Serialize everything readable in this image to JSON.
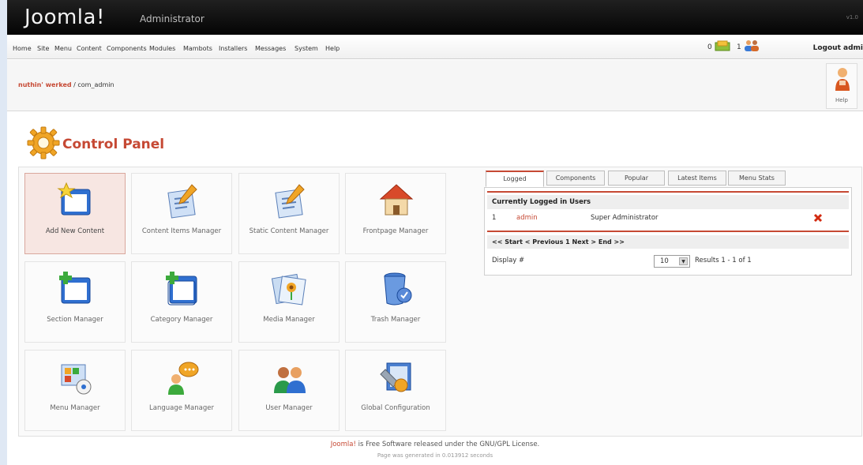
{
  "header": {
    "logo": "Joomla!",
    "subtitle": "Administrator",
    "version": "v1.0"
  },
  "menu": [
    "Home",
    "Site",
    "Menu",
    "Content",
    "Components",
    "Modules",
    "Mambots",
    "Installers",
    "Messages",
    "System",
    "Help"
  ],
  "status": {
    "messages_count": "0",
    "users_online": "1",
    "logout": "Logout admi"
  },
  "breadcrumb": {
    "site": "nuthin' werked",
    "sep": " / ",
    "page": "com_admin"
  },
  "help_label": "Help",
  "page_title": "Control Panel",
  "tiles": [
    {
      "label": "Add New Content",
      "icon": "add-content-icon",
      "active": true
    },
    {
      "label": "Content Items Manager",
      "icon": "content-items-icon"
    },
    {
      "label": "Static Content Manager",
      "icon": "static-content-icon"
    },
    {
      "label": "Frontpage Manager",
      "icon": "frontpage-home-icon"
    },
    {
      "label": "Section Manager",
      "icon": "section-icon"
    },
    {
      "label": "Category Manager",
      "icon": "category-icon"
    },
    {
      "label": "Media Manager",
      "icon": "media-icon"
    },
    {
      "label": "Trash Manager",
      "icon": "trash-icon"
    },
    {
      "label": "Menu Manager",
      "icon": "menu-icon"
    },
    {
      "label": "Language Manager",
      "icon": "language-icon"
    },
    {
      "label": "User Manager",
      "icon": "users-icon"
    },
    {
      "label": "Global Configuration",
      "icon": "config-icon"
    }
  ],
  "tabs": [
    "Logged",
    "Components",
    "Popular",
    "Latest Items",
    "Menu Stats"
  ],
  "logged": {
    "heading": "Currently Logged in Users",
    "row": {
      "num": "1",
      "user": "admin",
      "group": "Super Administrator"
    },
    "pagination": "<< Start < Previous 1 Next > End >>",
    "display_label": "Display #",
    "display_value": "10",
    "results": "Results 1 - 1 of 1"
  },
  "footer": {
    "joomla_link": "Joomla!",
    "license": " is Free Software released under the GNU/GPL License.",
    "generated": "Page was generated in 0.013912 seconds"
  },
  "colors": {
    "accent": "#c64934",
    "header_bg": "#111111",
    "tile_active_bg": "#f7e6e2"
  }
}
